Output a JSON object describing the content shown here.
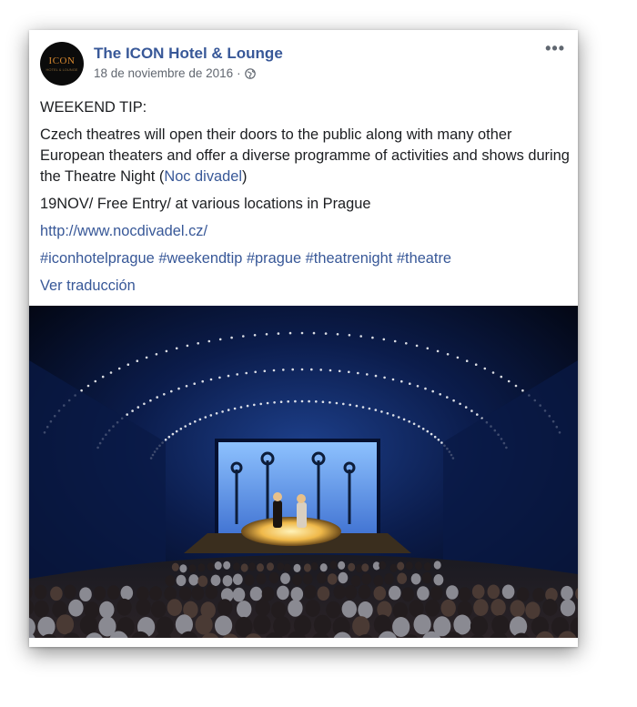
{
  "post": {
    "page_name": "The ICON Hotel & Lounge",
    "date": "18 de noviembre de 2016",
    "separator": "·",
    "visibility_icon": "globe-icon",
    "more_icon": "more-options-icon",
    "avatar": {
      "text": "ICON",
      "subtext": "HOTEL & LOUNGE"
    },
    "text": {
      "tip_heading": "WEEKEND TIP:",
      "paragraph_main": "Czech theatres will open their doors to the public along with many other European theaters and offer a diverse programme of activities and shows during the Theatre Night (",
      "paragraph_link": "Noc divadel",
      "paragraph_end": ")",
      "event_line": "19NOV/ Free Entry/ at various locations in Prague",
      "url": "http://www.nocdivadel.cz/",
      "hashtags": [
        "#iconhotelprague",
        "#weekendtip",
        "#prague",
        "#theatrenight",
        "#theatre"
      ],
      "translate_label": "Ver traducción"
    },
    "colors": {
      "link": "#385898",
      "text": "#1c1e21",
      "meta": "#616770"
    }
  }
}
